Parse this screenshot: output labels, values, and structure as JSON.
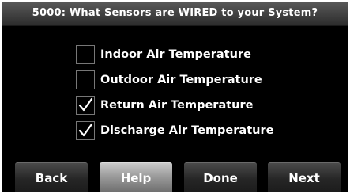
{
  "header": {
    "title": "5000: What Sensors are WIRED to your System?"
  },
  "sensors": [
    {
      "label": "Indoor Air Temperature",
      "checked": false
    },
    {
      "label": "Outdoor Air Temperature",
      "checked": false
    },
    {
      "label": "Return Air Temperature",
      "checked": true
    },
    {
      "label": "Discharge Air Temperature",
      "checked": true
    }
  ],
  "buttons": {
    "back": "Back",
    "help": "Help",
    "done": "Done",
    "next": "Next"
  },
  "icons": {
    "checkmark": "checkmark-icon"
  },
  "colors": {
    "background": "#000000",
    "text": "#ffffff",
    "help_button": "#9b9b9b"
  }
}
